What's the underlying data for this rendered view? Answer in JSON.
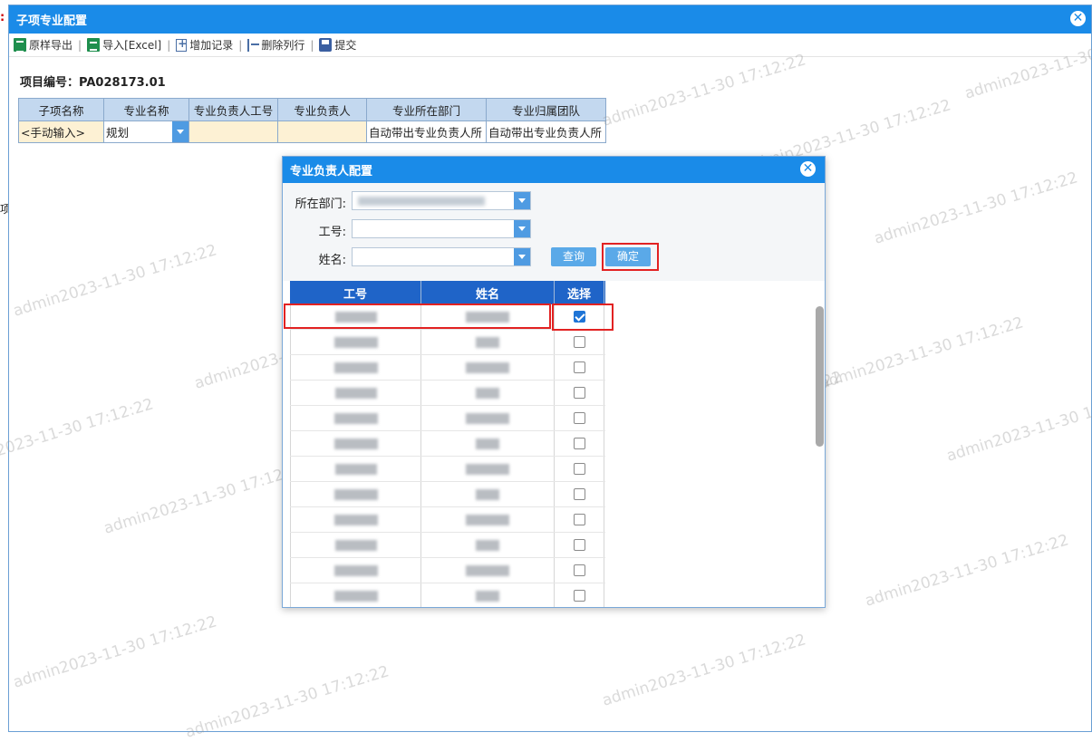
{
  "background": {
    "colon": ":",
    "left_char": "项"
  },
  "window": {
    "title": "子项专业配置",
    "close_icon": "✕",
    "toolbar": [
      {
        "label": "原样导出",
        "icon": "excel-export-icon"
      },
      {
        "label": "导入[Excel]",
        "icon": "excel-import-icon"
      },
      {
        "label": "增加记录",
        "icon": "add-record-icon"
      },
      {
        "label": "删除列行",
        "icon": "delete-row-icon"
      },
      {
        "label": "提交",
        "icon": "save-icon"
      }
    ],
    "separator": "|",
    "project": {
      "label": "项目编号：",
      "value": "PA028173.01"
    },
    "subtable": {
      "headers": [
        "子项名称",
        "专业名称",
        "专业负责人工号",
        "专业负责人",
        "专业所在部门",
        "专业归属团队"
      ],
      "row": [
        "<手动输入>",
        "规划",
        "",
        "",
        "自动带出专业负责人所",
        "自动带出专业负责人所"
      ]
    }
  },
  "dialog": {
    "title": "专业负责人配置",
    "close_icon": "✕",
    "labels": {
      "dept": "所在部门:",
      "id": "工号:",
      "name": "姓名:"
    },
    "buttons": {
      "query": "查询",
      "ok": "确定"
    },
    "grid": {
      "headers": [
        "工号",
        "姓名",
        "选择"
      ],
      "rows": [
        {
          "checked": true
        },
        {
          "checked": false
        },
        {
          "checked": false
        },
        {
          "checked": false
        },
        {
          "checked": false
        },
        {
          "checked": false
        },
        {
          "checked": false
        },
        {
          "checked": false
        },
        {
          "checked": false
        },
        {
          "checked": false
        },
        {
          "checked": false
        },
        {
          "checked": false
        }
      ]
    }
  },
  "watermark": "admin2023-11-30 17:12:22",
  "colors": {
    "title_bar": "#1a8be8",
    "grid_header": "#1f64c8",
    "highlight": "#e22222"
  }
}
